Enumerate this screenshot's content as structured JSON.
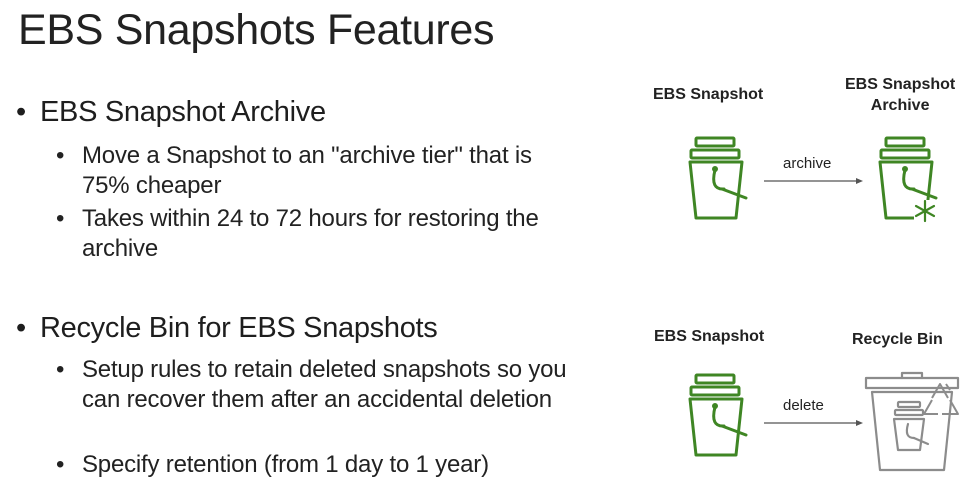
{
  "slide": {
    "title": "EBS Snapshots Features",
    "sections": [
      {
        "heading": "EBS Snapshot Archive",
        "bullets": [
          "Move a Snapshot to an \"archive tier\" that is 75% cheaper",
          "Takes within 24 to 72 hours for restoring the archive"
        ]
      },
      {
        "heading": "Recycle Bin for EBS Snapshots",
        "bullets": [
          "Setup rules to retain deleted snapshots so you can recover them after an accidental deletion",
          "Specify retention (from 1 day to 1 year)"
        ]
      }
    ],
    "bullet_glyph": "•"
  },
  "diagrams": {
    "archive": {
      "source_label": "EBS Snapshot",
      "target_label_line1": "EBS Snapshot",
      "target_label_line2": "Archive",
      "action_label": "archive"
    },
    "delete": {
      "source_label": "EBS Snapshot",
      "target_label": "Recycle Bin",
      "action_label": "delete"
    }
  },
  "icons": {
    "snapshot": "ebs-snapshot-bucket-icon",
    "archive": "ebs-snapshot-archive-icon",
    "recycle_bin": "recycle-bin-icon"
  },
  "colors": {
    "icon_green": "#3f8624",
    "icon_gray": "#8c8c8c",
    "arrow": "#555555"
  }
}
